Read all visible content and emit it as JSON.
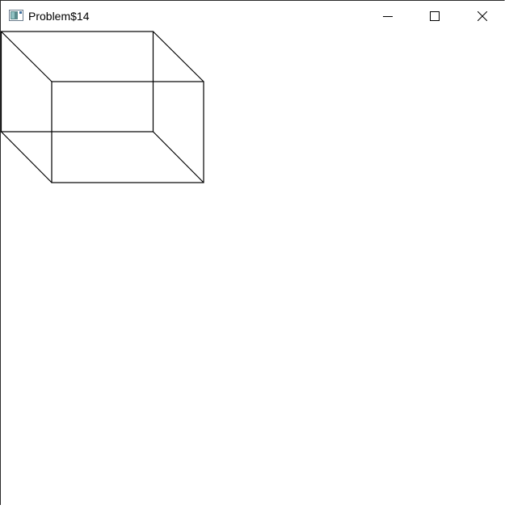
{
  "window": {
    "title": "Problem$14",
    "icon": "java-app-icon",
    "controls": {
      "minimize": "minimize-icon",
      "maximize": "maximize-icon",
      "close": "close-icon"
    }
  },
  "canvas": {
    "content": "wireframe-cuboid",
    "stroke_color": "#000000",
    "background": "#ffffff"
  }
}
